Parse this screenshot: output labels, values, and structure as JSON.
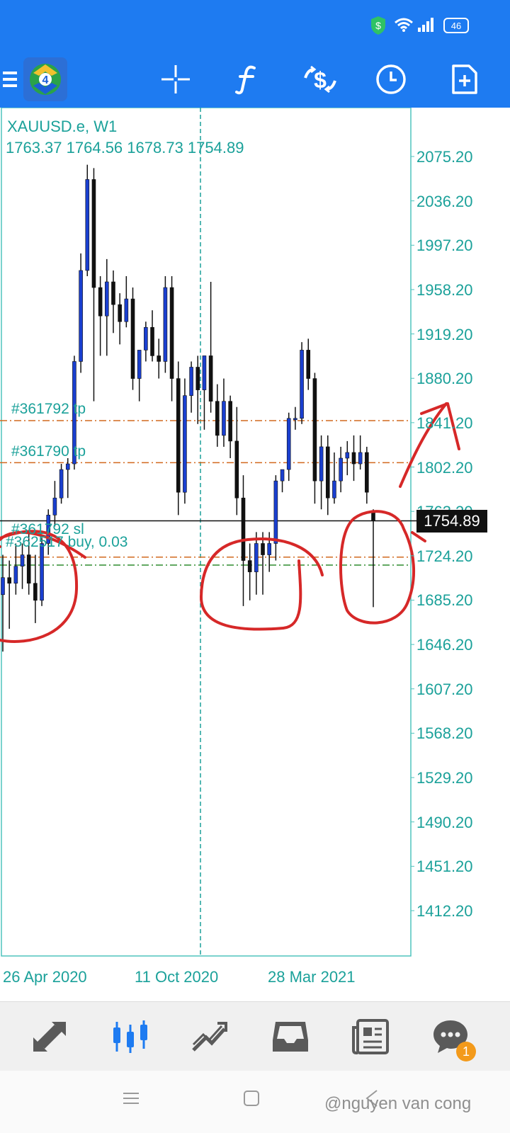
{
  "status_bar": {
    "battery": "46",
    "icons": [
      "shield-dollar-icon",
      "wifi-icon",
      "signal-icon",
      "battery-icon"
    ]
  },
  "toolbar": {
    "icons": [
      "menu-icon",
      "metatrader-logo",
      "crosshair-icon",
      "function-icon",
      "trade-icon",
      "timeframe-icon",
      "template-icon"
    ],
    "accent": "#1e7bf1"
  },
  "chart": {
    "symbol": "XAUUSD.e, W1",
    "ohlc": "1763.37 1764.56 1678.73 1754.89",
    "current_price": "1754.89",
    "level_labels": [
      {
        "text": "#361792 tp"
      },
      {
        "text": "#361790 tp"
      },
      {
        "text": "#361792 sl"
      },
      {
        "text": "#362517 buy, 0.03"
      }
    ]
  },
  "chart_data": {
    "type": "candlestick",
    "symbol": "XAUUSD.e",
    "timeframe": "W1",
    "y_ticks": [
      "2075.20",
      "2036.20",
      "1997.20",
      "1958.20",
      "1919.20",
      "1880.20",
      "1841.20",
      "1802.20",
      "1763.20",
      "1724.20",
      "1685.20",
      "1646.20",
      "1607.20",
      "1568.20",
      "1529.20",
      "1490.20",
      "1451.20",
      "1412.20"
    ],
    "x_ticks": [
      "26 Apr 2020",
      "11 Oct 2020",
      "28 Mar 2021"
    ],
    "ylim": [
      1378,
      2110
    ],
    "levels": [
      {
        "name": "#361792 tp",
        "price": 1843
      },
      {
        "name": "#361790 tp",
        "price": 1806
      },
      {
        "name": "#361792 sl",
        "price": 1723
      },
      {
        "name": "#362517 buy, 0.03",
        "price": 1716
      },
      {
        "name": "current",
        "price": 1754.89
      }
    ],
    "colors": {
      "bull": "#1a3fcf",
      "bear": "#111111",
      "axis_text": "#1ba19a",
      "tp_line": "#d2691e",
      "buy_line": "#2e8b2e",
      "annotation": "#d62828"
    },
    "candles": [
      [
        1690,
        1725,
        1640,
        1705
      ],
      [
        1705,
        1720,
        1660,
        1700
      ],
      [
        1700,
        1735,
        1690,
        1715
      ],
      [
        1715,
        1735,
        1695,
        1725
      ],
      [
        1725,
        1745,
        1690,
        1700
      ],
      [
        1700,
        1725,
        1665,
        1685
      ],
      [
        1685,
        1740,
        1680,
        1735
      ],
      [
        1735,
        1765,
        1725,
        1760
      ],
      [
        1760,
        1790,
        1750,
        1775
      ],
      [
        1775,
        1805,
        1770,
        1800
      ],
      [
        1800,
        1810,
        1775,
        1805
      ],
      [
        1805,
        1900,
        1800,
        1895
      ],
      [
        1895,
        1990,
        1885,
        1975
      ],
      [
        1975,
        2068,
        1970,
        2055
      ],
      [
        2055,
        2065,
        1860,
        1960
      ],
      [
        1960,
        1970,
        1900,
        1935
      ],
      [
        1935,
        1985,
        1900,
        1965
      ],
      [
        1965,
        1975,
        1920,
        1945
      ],
      [
        1945,
        1955,
        1910,
        1930
      ],
      [
        1930,
        1970,
        1925,
        1950
      ],
      [
        1950,
        1960,
        1870,
        1880
      ],
      [
        1880,
        1900,
        1860,
        1905
      ],
      [
        1905,
        1930,
        1895,
        1925
      ],
      [
        1925,
        1940,
        1895,
        1900
      ],
      [
        1900,
        1915,
        1880,
        1895
      ],
      [
        1895,
        1970,
        1885,
        1960
      ],
      [
        1960,
        1970,
        1860,
        1880
      ],
      [
        1880,
        1895,
        1760,
        1780
      ],
      [
        1780,
        1880,
        1770,
        1865
      ],
      [
        1865,
        1895,
        1850,
        1890
      ],
      [
        1890,
        1900,
        1840,
        1870
      ],
      [
        1870,
        1900,
        1835,
        1900
      ],
      [
        1900,
        1965,
        1850,
        1860
      ],
      [
        1860,
        1875,
        1820,
        1830
      ],
      [
        1830,
        1880,
        1820,
        1860
      ],
      [
        1860,
        1865,
        1810,
        1825
      ],
      [
        1825,
        1855,
        1760,
        1775
      ],
      [
        1775,
        1795,
        1680,
        1720
      ],
      [
        1720,
        1735,
        1685,
        1710
      ],
      [
        1710,
        1745,
        1690,
        1735
      ],
      [
        1735,
        1745,
        1690,
        1725
      ],
      [
        1725,
        1745,
        1710,
        1735
      ],
      [
        1735,
        1795,
        1720,
        1790
      ],
      [
        1790,
        1800,
        1780,
        1800
      ],
      [
        1800,
        1850,
        1790,
        1845
      ],
      [
        1845,
        1855,
        1835,
        1845
      ],
      [
        1845,
        1912,
        1840,
        1905
      ],
      [
        1905,
        1915,
        1870,
        1880
      ],
      [
        1880,
        1885,
        1770,
        1790
      ],
      [
        1790,
        1830,
        1765,
        1820
      ],
      [
        1820,
        1830,
        1760,
        1775
      ],
      [
        1775,
        1815,
        1770,
        1790
      ],
      [
        1790,
        1820,
        1780,
        1810
      ],
      [
        1810,
        1825,
        1795,
        1815
      ],
      [
        1815,
        1830,
        1790,
        1805
      ],
      [
        1805,
        1830,
        1800,
        1815
      ],
      [
        1815,
        1820,
        1770,
        1780
      ],
      [
        1764,
        1765,
        1679,
        1755
      ]
    ]
  },
  "bottom_nav": {
    "items": [
      {
        "name": "quotes",
        "icon": "quotes-icon"
      },
      {
        "name": "chart",
        "icon": "candlestick-icon"
      },
      {
        "name": "trade",
        "icon": "trade-graph-icon"
      },
      {
        "name": "history",
        "icon": "inbox-icon"
      },
      {
        "name": "news",
        "icon": "news-icon"
      },
      {
        "name": "messages",
        "icon": "chat-icon"
      }
    ],
    "badge": "1"
  },
  "system_nav": {
    "icons": [
      "recents-icon",
      "home-icon",
      "back-icon"
    ]
  },
  "watermark": "@nguyen van cong"
}
